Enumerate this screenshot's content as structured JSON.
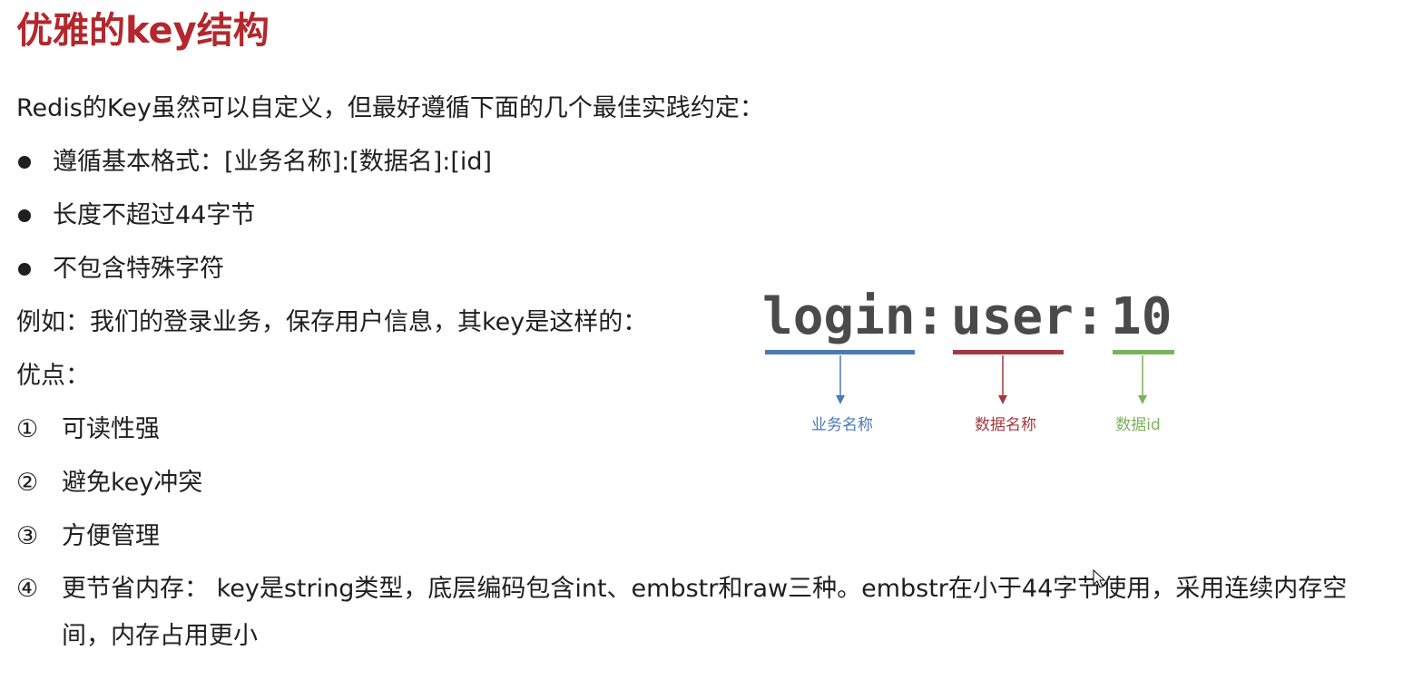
{
  "title": "优雅的key结构",
  "intro": "Redis的Key虽然可以自定义，但最好遵循下面的几个最佳实践约定：",
  "rules": [
    "遵循基本格式：[业务名称]:[数据名]:[id]",
    "长度不超过44字节",
    "不包含特殊字符"
  ],
  "example_text": "例如：我们的登录业务，保存用户信息，其key是这样的：",
  "advantages_label": "优点：",
  "advantages": [
    {
      "marker": "①",
      "text": "可读性强"
    },
    {
      "marker": "②",
      "text": "避免key冲突"
    },
    {
      "marker": "③",
      "text": "方便管理"
    },
    {
      "marker": "④",
      "text": "更节省内存： key是string类型，底层编码包含int、embstr和raw三种。embstr在小于44字节使用，采用连续内存空间，内存占用更小"
    }
  ],
  "diagram": {
    "key_parts": [
      "login",
      ":",
      "user",
      ":",
      "10"
    ],
    "labels": [
      {
        "text": "业务名称",
        "color": "#4a7ab8"
      },
      {
        "text": "数据名称",
        "color": "#a33a40"
      },
      {
        "text": "数据id",
        "color": "#7bb35b"
      }
    ],
    "key_color": "#4a4a4a"
  }
}
